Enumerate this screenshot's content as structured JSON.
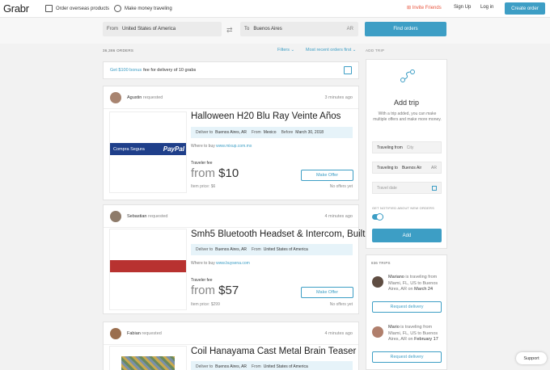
{
  "nav": {
    "logo": "Grabr",
    "order_overseas": "Order overseas products",
    "make_money": "Make money traveling",
    "invite": "Invite Friends",
    "signup": "Sign Up",
    "login": "Log in",
    "create_order": "Create order"
  },
  "search": {
    "from_label": "From",
    "from_value": "United States of America",
    "to_label": "To",
    "to_value": "Buenos Aires",
    "to_code": "AR",
    "find_button": "Find orders"
  },
  "orders_bar": {
    "count": "36,386 ORDERS",
    "filters": "Filters",
    "sort": "Most recent orders first"
  },
  "bonus": {
    "link": "Get $100 bonus",
    "text": "fee for delivery of 10 grabs"
  },
  "orders": [
    {
      "user": "Agustin",
      "action": "requested",
      "time": "3 minutes ago",
      "title": "Halloween H20 Blu Ray Veinte Años",
      "deliver_label": "Deliver to",
      "deliver_to": "Buenos Aires, AR",
      "from_label": "From",
      "from": "Mexico",
      "before_label": "Before",
      "before": "March 30, 2018",
      "where_label": "Where to buy",
      "where": "www.mixup.com.mx",
      "fee_label": "Traveler fee",
      "price_from": "from",
      "price": "$10",
      "item_price": "Item price: $6",
      "offer_button": "Make Offer",
      "offers": "No offers yet",
      "thumb_text_a": "Compra Segura",
      "thumb_text_b": "PayPal"
    },
    {
      "user": "Sebastian",
      "action": "requested",
      "time": "4 minutes ago",
      "title": "Smh5 Bluetooth Headset & Intercom, Built",
      "deliver_label": "Deliver to",
      "deliver_to": "Buenos Aires, AR",
      "from_label": "From",
      "from": "United States of America",
      "where_label": "Where to buy",
      "where": "www.buysena.com",
      "fee_label": "Traveler fee",
      "price_from": "from",
      "price": "$57",
      "item_price": "Item price: $299",
      "offer_button": "Make Offer",
      "offers": "No offers yet"
    },
    {
      "user": "Fabian",
      "action": "requested",
      "time": "4 minutes ago",
      "title": "Coil Hanayama Cast Metal Brain Teaser",
      "deliver_label": "Deliver to",
      "deliver_to": "Buenos Aires, AR",
      "from_label": "From",
      "from": "United States of America"
    }
  ],
  "add_trip": {
    "header": "ADD TRIP",
    "title": "Add trip",
    "description": "With a trip added, you can make multiple offers and make more money.",
    "from_label": "Traveling from",
    "from_placeholder": "City",
    "to_label": "Traveling to",
    "to_value": "Buenos Air",
    "to_code": "AR",
    "date_placeholder": "Travel date",
    "notify": "GET NOTIFIED ABOUT NEW ORDERS",
    "add_button": "Add"
  },
  "trips": {
    "header": "836 TRIPS",
    "items": [
      {
        "name": "Mariano",
        "text_a": "is traveling from",
        "text_b": "Miami, FL, US to Buenos Aires, AR",
        "on": "on",
        "date": "March 24",
        "button": "Request delivery"
      },
      {
        "name": "Mario",
        "text_a": "is traveling from",
        "text_b": "Miami, FL, US to Buenos Aires, AR",
        "on": "on",
        "date": "February 17",
        "button": "Request delivery"
      }
    ]
  },
  "support": "Support",
  "colors": {
    "accent": "#3d9ec5",
    "invite": "#e8553e"
  }
}
